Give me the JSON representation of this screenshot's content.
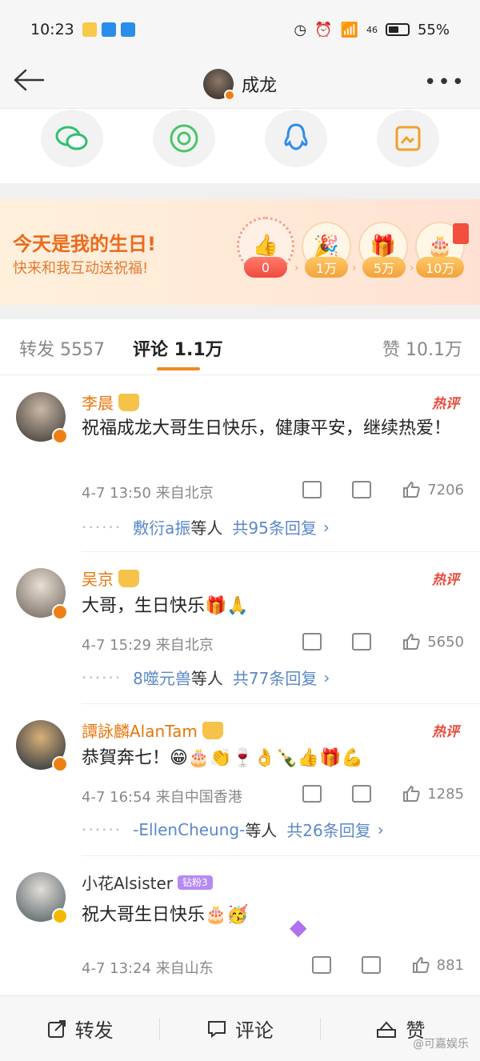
{
  "status_bar": {
    "time": "10:23",
    "battery": "55%",
    "network": "46"
  },
  "nav": {
    "title": "成龙"
  },
  "birthday": {
    "title": "今天是我的生日!",
    "subtitle": "快来和我互动送祝福!",
    "tiers": [
      "0",
      "1万",
      "5万",
      "10万"
    ]
  },
  "tabs": {
    "repost": "转发 5557",
    "comments": "评论 1.1万",
    "likes": "赞 10.1万"
  },
  "hot_label": "热评",
  "comments": [
    {
      "name": "李晨",
      "text": "祝福成龙大哥生日快乐，健康平安，继续热爱！",
      "meta": "4-7 13:50 来自北京",
      "likes": "7206",
      "reply_who": "敷衍a振",
      "reply_tail": "等人",
      "reply_count": "共95条回复"
    },
    {
      "name": "吴京",
      "text": "大哥，生日快乐🎁🙏",
      "meta": "4-7 15:29 来自北京",
      "likes": "5650",
      "reply_who": "8噬元兽",
      "reply_tail": "等人",
      "reply_count": "共77条回复"
    },
    {
      "name": "譚詠麟AlanTam",
      "text": "恭賀奔七！😁🎂👏🍷👌🍾👍🎁💪",
      "meta": "4-7 16:54 来自中国香港",
      "likes": "1285",
      "reply_who": "-EllenCheung-",
      "reply_tail": "等人",
      "reply_count": "共26条回复"
    },
    {
      "name": "小花Alsister",
      "fan_badge": "钻粉3",
      "text": "祝大哥生日快乐🎂🥳",
      "meta": "4-7 13:24 来自山东",
      "likes": "881"
    }
  ],
  "bottom_bar": {
    "repost": "转发",
    "comment": "评论",
    "like": "赞"
  },
  "watermark": "@可嘉娱乐"
}
